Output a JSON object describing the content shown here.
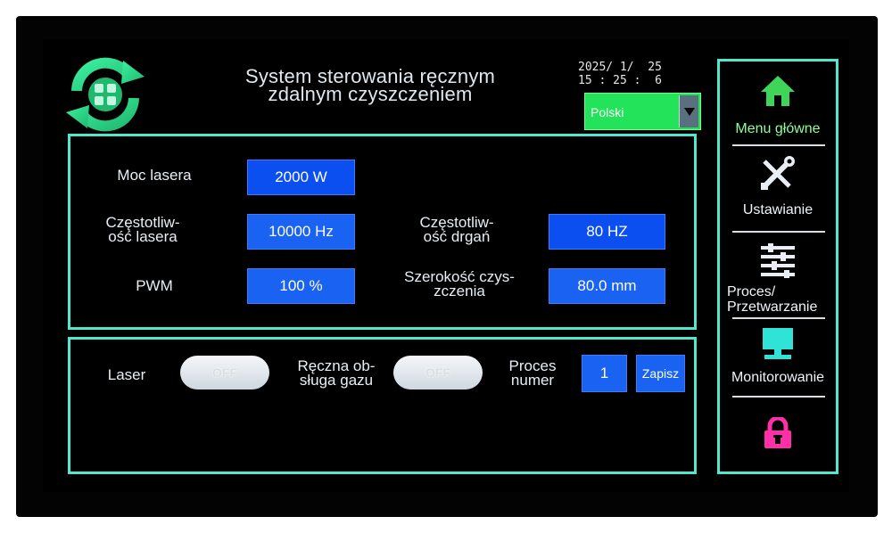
{
  "header": {
    "title_line1": "System sterowania ręcznym",
    "title_line2": "zdalnym czyszczeniem",
    "date": "2025/ 1/  25",
    "time": "15 : 25 :  6",
    "language": "Polski"
  },
  "params": {
    "laser_power_label": "Moc lasera",
    "laser_power_value": "2000 W",
    "laser_freq_label_1": "Częstotliw-",
    "laser_freq_label_2": "ość lasera",
    "laser_freq_value": "10000 Hz",
    "vib_freq_label_1": "Częstotliw-",
    "vib_freq_label_2": "ość drgań",
    "vib_freq_value": "80 HZ",
    "pwm_label": "PWM",
    "pwm_value": "100 %",
    "width_label_1": "Szerokość czys-",
    "width_label_2": "zczenia",
    "width_value": "80.0 mm"
  },
  "controls": {
    "laser_label": "Laser",
    "laser_toggle": "OFF",
    "gas_label_1": "Ręczna ob-",
    "gas_label_2": "sługa gazu",
    "gas_toggle": "OFF",
    "process_label_1": "Proces",
    "process_label_2": "numer",
    "process_value": "1",
    "save_label": "Zapisz"
  },
  "sidebar": {
    "items": [
      {
        "label": "Menu główne",
        "icon": "home-icon"
      },
      {
        "label": "Ustawianie",
        "icon": "tools-icon"
      },
      {
        "label_1": "Proces/",
        "label_2": "Przetwarzanie",
        "icon": "sliders-icon"
      },
      {
        "label": "Monitorowanie",
        "icon": "monitor-icon"
      },
      {
        "icon": "lock-icon"
      }
    ]
  },
  "colors": {
    "panel_border": "#4fe8cf",
    "value_box": "#0c4ff0",
    "language_box": "#22e35a",
    "home_icon": "#3fd45a",
    "lock_icon": "#ff2fa8"
  }
}
